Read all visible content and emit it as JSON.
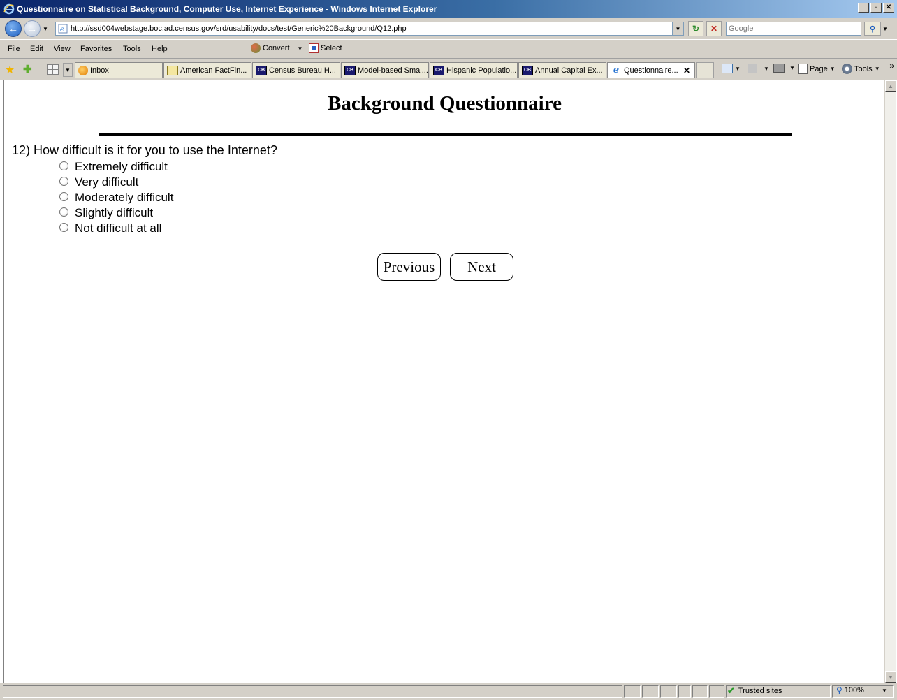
{
  "window": {
    "title": "Questionnaire on Statistical Background, Computer Use, Internet Experience - Windows Internet Explorer",
    "controls": [
      "_",
      "▫",
      "✕"
    ]
  },
  "address": {
    "url": "http://ssd004webstage.boc.ad.census.gov/srd/usability/docs/test/Generic%20Background/Q12.php",
    "search_placeholder": "Google"
  },
  "menu": {
    "items": [
      {
        "accel": "F",
        "rest": "ile"
      },
      {
        "accel": "E",
        "rest": "dit"
      },
      {
        "accel": "V",
        "rest": "iew"
      },
      {
        "accel": "",
        "rest": "F",
        "full": "Favorites"
      },
      {
        "accel": "T",
        "rest": "ools"
      },
      {
        "accel": "H",
        "rest": "elp"
      }
    ],
    "convert_label": "Convert",
    "select_label": "Select"
  },
  "tabs": [
    {
      "label": "Inbox",
      "icon": "inbox-icon"
    },
    {
      "label": "American FactFin...",
      "icon": "factfinder-icon"
    },
    {
      "label": "Census Bureau H...",
      "icon": "census-icon"
    },
    {
      "label": "Model-based Smal...",
      "icon": "census-icon"
    },
    {
      "label": "Hispanic Populatio...",
      "icon": "census-icon"
    },
    {
      "label": "Annual Capital Ex...",
      "icon": "census-icon"
    },
    {
      "label": "Questionnaire...",
      "icon": "ie-icon",
      "active": true
    }
  ],
  "commandbar": {
    "page_label": "Page",
    "tools_label": "Tools"
  },
  "page": {
    "heading": "Background Questionnaire",
    "question": "12) How difficult is it for you to use the Internet?",
    "options": [
      "Extremely difficult",
      "Very difficult",
      "Moderately difficult",
      "Slightly difficult",
      "Not difficult at all"
    ],
    "selected_option": null,
    "previous_label": "Previous",
    "next_label": "Next"
  },
  "status": {
    "zone": "Trusted sites",
    "zoom": "100%"
  }
}
